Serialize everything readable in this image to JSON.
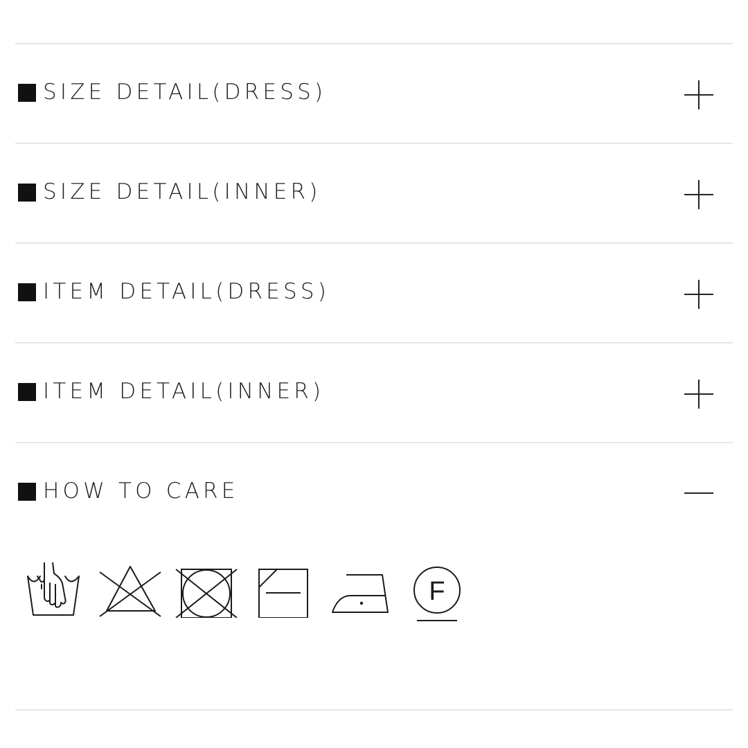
{
  "sections": [
    {
      "label": "SIZE DETAIL(DRESS)",
      "state": "collapsed",
      "toggle_icon": "plus-icon"
    },
    {
      "label": "SIZE DETAIL(INNER)",
      "state": "collapsed",
      "toggle_icon": "plus-icon"
    },
    {
      "label": "ITEM DETAIL(DRESS)",
      "state": "collapsed",
      "toggle_icon": "plus-icon"
    },
    {
      "label": "ITEM DETAIL(INNER)",
      "state": "collapsed",
      "toggle_icon": "plus-icon"
    },
    {
      "label": "HOW TO CARE",
      "state": "expanded",
      "toggle_icon": "minus-icon"
    }
  ],
  "care_symbols": [
    {
      "icon": "hand-wash-icon"
    },
    {
      "icon": "do-not-bleach-icon"
    },
    {
      "icon": "do-not-tumble-dry-icon"
    },
    {
      "icon": "dry-flat-in-shade-icon"
    },
    {
      "icon": "iron-low-heat-icon"
    },
    {
      "icon": "dry-clean-f-icon",
      "letter": "F"
    }
  ],
  "colors": {
    "text": "#1e1e1e",
    "bullet": "#111111",
    "divider": "#e6e6e6",
    "background": "#ffffff"
  }
}
